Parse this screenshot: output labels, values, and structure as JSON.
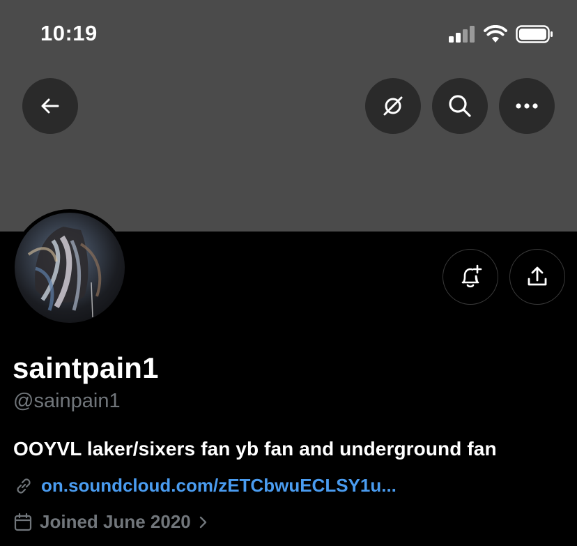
{
  "status_bar": {
    "time": "10:19",
    "icons": [
      "cellular-signal-icon",
      "wifi-icon",
      "battery-icon"
    ]
  },
  "header": {
    "buttons": [
      "back-arrow-icon",
      "grok-icon",
      "search-icon",
      "more-icon"
    ]
  },
  "profile": {
    "display_name": "saintpain1",
    "handle": "@sainpain1",
    "bio": "OOYVL laker/sixers fan yb fan and underground fan",
    "link": "on.soundcloud.com/zETCbwuECLSY1u...",
    "joined": "Joined June 2020",
    "actions": [
      "notification-bell-plus-icon",
      "share-icon"
    ]
  },
  "colors": {
    "banner": "#4b4b4b",
    "background": "#000000",
    "link": "#4a9cf0",
    "muted": "#71767b"
  }
}
